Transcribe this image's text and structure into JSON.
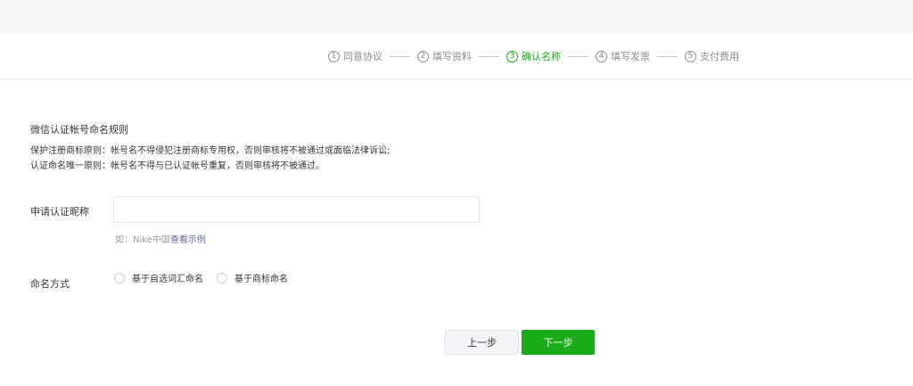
{
  "steps": [
    {
      "num": "1",
      "label": "同意协议",
      "active": false
    },
    {
      "num": "2",
      "label": "填写资料",
      "active": false
    },
    {
      "num": "3",
      "label": "确认名称",
      "active": true
    },
    {
      "num": "4",
      "label": "填写发票",
      "active": false
    },
    {
      "num": "5",
      "label": "支付费用",
      "active": false
    }
  ],
  "rules": {
    "title": "微信认证帐号命名规则",
    "line1": "保护注册商标原则：帐号名不得侵犯注册商标专用权，否则审核将不被通过或面临法律诉讼;",
    "line2": "认证命名唯一原则：帐号名不得与已认证帐号重复，否则审核将不被通过。"
  },
  "nickname": {
    "label": "申请认证昵称",
    "value": "",
    "placeholder": "",
    "hint_prefix": "如：Nike中国",
    "hint_link": "查看示例"
  },
  "naming_method": {
    "label": "命名方式",
    "options": [
      "基于自选词汇命名",
      "基于商标命名"
    ]
  },
  "buttons": {
    "prev": "上一步",
    "next": "下一步"
  },
  "colors": {
    "accent": "#1aad19",
    "link": "#576b95",
    "background": "#f6f7f9"
  }
}
